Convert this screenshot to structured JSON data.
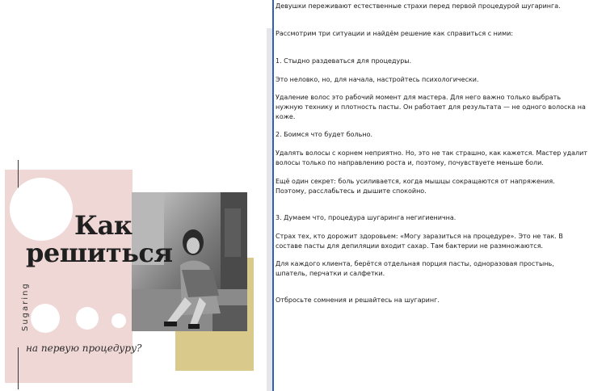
{
  "poster": {
    "title_line1": "Как",
    "title_line2": "решиться",
    "vertical_word": "Sugaring",
    "subtitle": "на первую процедуру?",
    "accent_pink": "#efd7d5",
    "accent_gold": "#d9c98a"
  },
  "article": {
    "p1": "Девушки переживают естественные страхи перед первой процедурой шугаринга.",
    "p2": "Рассмотрим три ситуации и найдём решение как справиться с ними:",
    "p3": "1. Стыдно раздеваться для процедуры.",
    "p4": "Это неловко, но, для начала, настройтесь психологически.",
    "p5": "Удаление волос это рабочий момент для мастера. Для него важно только выбрать нужную технику и плотность пасты. Он работает для результата — не одного волоска на коже.",
    "p6": "2. Боимся что будет больно.",
    "p7": "Удалять волосы с корнем неприятно. Но, это не так страшно, как кажется. Мастер удалит волосы только по направлению роста и, поэтому, почувствуете меньше боли.",
    "p8": "Ещё один секрет: боль усиливается, когда мышцы сокращаются от напряжения. Поэтому, расслабьтесь и дышите спокойно.",
    "p9": "3. Думаем что, процедура шугаринга негигиенична.",
    "p10": "Страх тех, кто дорожит здоровьем: «Могу заразиться на процедуре». Это не так. В составе пасты для депиляции входит сахар. Там бактерии не размножаются.",
    "p11": "Для каждого клиента, берётся отдельная порция пасты, одноразовая простынь, шпатель, перчатки и салфетки.",
    "p12": "Отбросьте сомнения и решайтесь на шугаринг."
  },
  "colors": {
    "divider": "#2f5fb8",
    "scrollbar": "#e6e6ea"
  }
}
